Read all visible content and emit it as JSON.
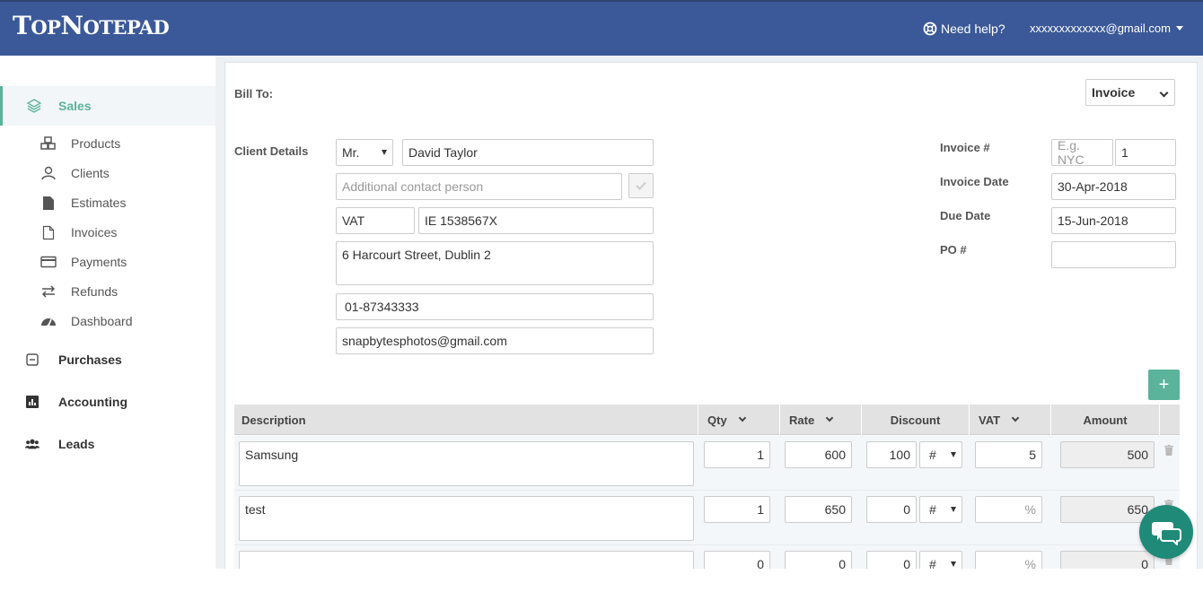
{
  "app": {
    "logo_big_t": "T",
    "logo_op": "OP",
    "logo_big_n": "N",
    "logo_otepad": "OTEPAD"
  },
  "header": {
    "help_label": "Need help?",
    "user_email": "xxxxxxxxxxxxx@gmail.com"
  },
  "sidebar": {
    "sales": "Sales",
    "sub_items": [
      {
        "label": "Products",
        "icon": "cubes-icon"
      },
      {
        "label": "Clients",
        "icon": "clients-icon"
      },
      {
        "label": "Estimates",
        "icon": "file-icon"
      },
      {
        "label": "Invoices",
        "icon": "file-outline-icon"
      },
      {
        "label": "Payments",
        "icon": "credit-card-icon"
      },
      {
        "label": "Refunds",
        "icon": "exchange-icon"
      },
      {
        "label": "Dashboard",
        "icon": "dashboard-icon"
      }
    ],
    "purchases": "Purchases",
    "accounting": "Accounting",
    "leads": "Leads"
  },
  "form": {
    "bill_to": "Bill To:",
    "doc_type": "Invoice",
    "client_details": "Client Details",
    "title_value": "Mr.",
    "client_name": "David Taylor",
    "contact_placeholder": "Additional contact person",
    "tax_type": "VAT",
    "tax_number": "IE 1538567X",
    "address": "6 Harcourt Street, Dublin 2",
    "phone": "01-87343333",
    "email": "snapbytesphotos@gmail.com",
    "invoice_no_label": "Invoice #",
    "invoice_prefix_placeholder": "E.g. NYC",
    "invoice_no": "1",
    "invoice_date_label": "Invoice Date",
    "invoice_date": "30-Apr-2018",
    "due_date_label": "Due Date",
    "due_date": "15-Jun-2018",
    "po_label": "PO #",
    "po_value": "",
    "add_label": "+"
  },
  "table": {
    "headers": {
      "description": "Description",
      "qty": "Qty",
      "rate": "Rate",
      "discount": "Discount",
      "vat": "VAT",
      "amount": "Amount"
    },
    "rows": [
      {
        "description": "Samsung",
        "qty": "1",
        "rate": "600",
        "discount": "100",
        "discount_type": "#",
        "vat": "5",
        "vat_placeholder": "",
        "amount": "500"
      },
      {
        "description": "test",
        "qty": "1",
        "rate": "650",
        "discount": "0",
        "discount_type": "#",
        "vat": "",
        "vat_placeholder": "%",
        "amount": "650"
      },
      {
        "description": "",
        "qty": "0",
        "rate": "0",
        "discount": "0",
        "discount_type": "#",
        "vat": "",
        "vat_placeholder": "%",
        "amount": "0"
      }
    ]
  }
}
